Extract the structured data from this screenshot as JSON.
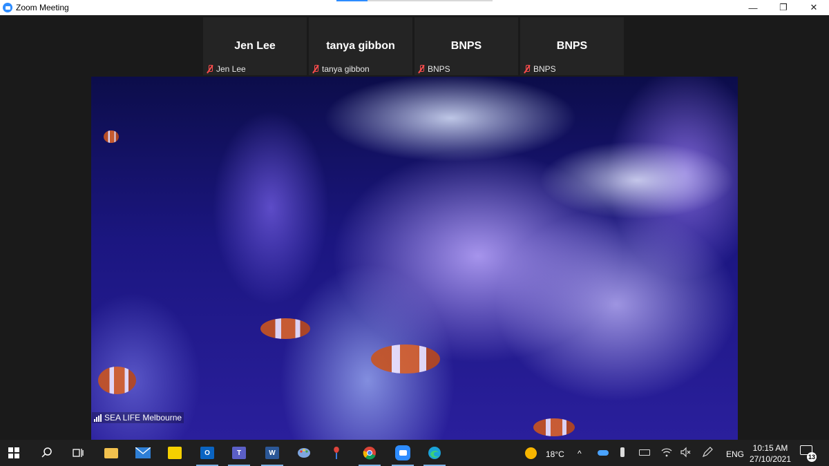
{
  "window": {
    "title": "Zoom Meeting",
    "minimize_glyph": "—",
    "restore_glyph": "❐",
    "close_glyph": "✕"
  },
  "loading_progress": 0.2,
  "participants": [
    {
      "display_name": "Jen Lee",
      "label": "Jen Lee",
      "muted": true
    },
    {
      "display_name": "tanya gibbon",
      "label": "tanya gibbon",
      "muted": true
    },
    {
      "display_name": "BNPS",
      "label": "BNPS",
      "muted": true
    },
    {
      "display_name": "BNPS",
      "label": "BNPS",
      "muted": true
    }
  ],
  "active_speaker": {
    "label": "SEA LIFE Melbourne",
    "icon": "signal-strength-icon"
  },
  "taskbar": {
    "apps": [
      {
        "name": "start-icon"
      },
      {
        "name": "search-icon"
      },
      {
        "name": "task-view-icon"
      },
      {
        "name": "file-explorer-icon",
        "color": "#f2c14e"
      },
      {
        "name": "mail-icon",
        "color": "#2e7fd6"
      },
      {
        "name": "sticky-notes-icon",
        "color": "#f5d000"
      },
      {
        "name": "outlook-icon",
        "color": "#0a64c2",
        "glyph": "O"
      },
      {
        "name": "teams-icon",
        "color": "#5b5fc7",
        "glyph": "T"
      },
      {
        "name": "word-icon",
        "color": "#2b5797",
        "glyph": "W"
      },
      {
        "name": "paint-icon",
        "color": "#7ea6e0"
      },
      {
        "name": "snip-icon",
        "color": "#e0443c"
      },
      {
        "name": "chrome-icon",
        "color": "#db4437"
      },
      {
        "name": "zoom-icon",
        "color": "#2d8cff"
      },
      {
        "name": "edge-icon",
        "color": "#1aa3d9"
      }
    ],
    "weather": {
      "temp": "18°C",
      "icon": "sun-icon"
    },
    "tray_chevron": "^",
    "language": "ENG",
    "time": "10:15 AM",
    "date": "27/10/2021",
    "notification_count": "13"
  }
}
